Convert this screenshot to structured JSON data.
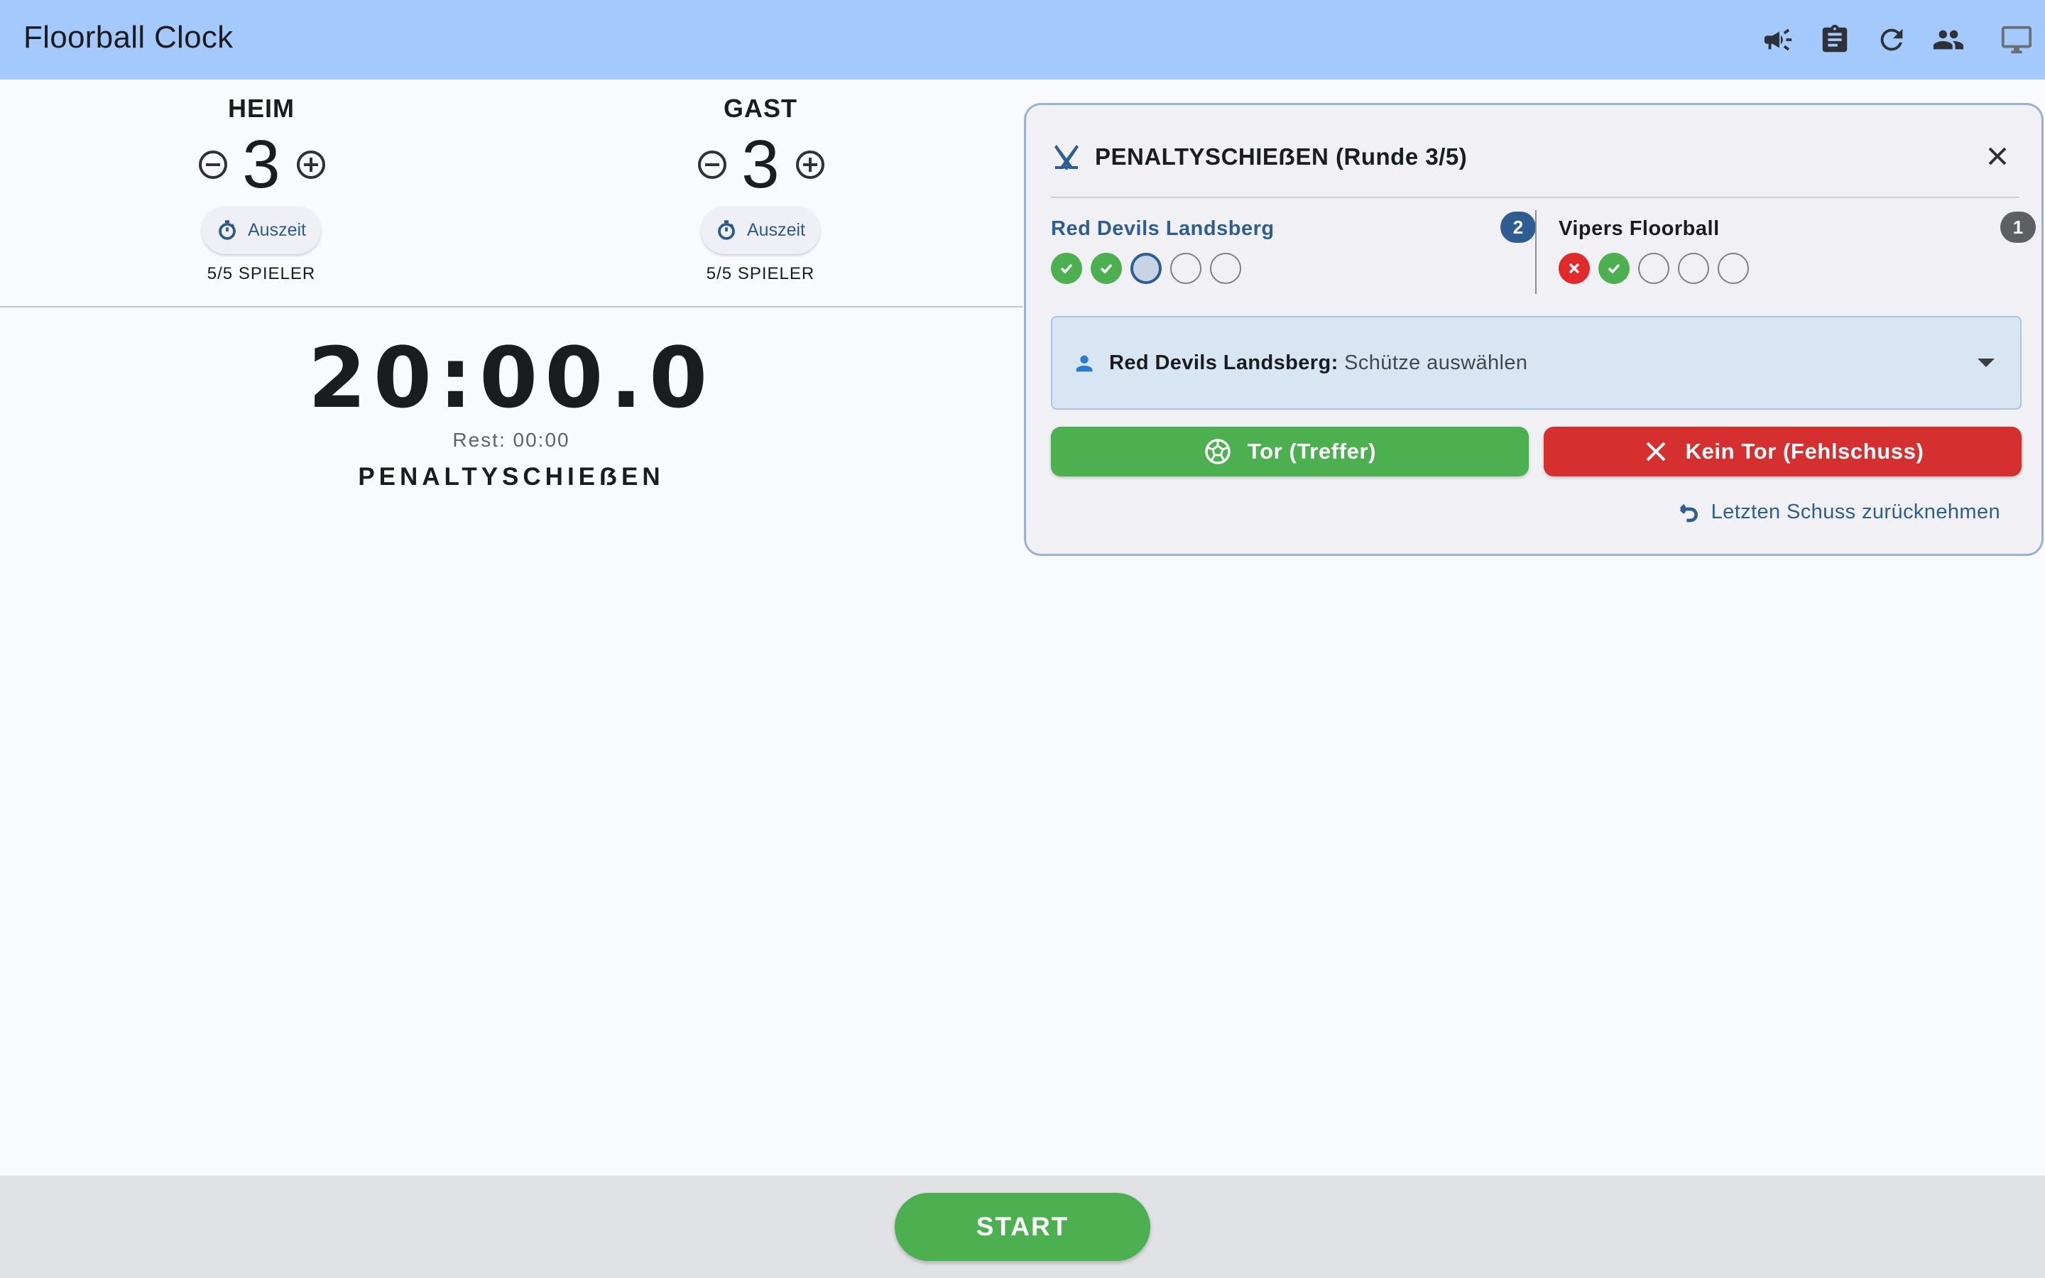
{
  "app": {
    "title": "Floorball Clock",
    "icons": [
      "announcement-icon",
      "clipboard-icon",
      "refresh-icon",
      "group-icon",
      "display-icon"
    ]
  },
  "home": {
    "label": "HEIM",
    "score": "3",
    "timeout_label": "Auszeit",
    "players": "5/5 SPIELER"
  },
  "guest": {
    "label": "GAST",
    "score": "3",
    "timeout_label": "Auszeit",
    "players": "5/5 SPIELER"
  },
  "clock": {
    "time": "20:00.0",
    "rest": "Rest: 00:00",
    "phase": "PENALTYSCHIEẞEN"
  },
  "penalty": {
    "title": "PENALTYSCHIEẞEN (Runde 3/5)",
    "home_team": {
      "name": "Red Devils Landsberg",
      "goals": "2",
      "shots": [
        "hit",
        "hit",
        "current",
        "empty",
        "empty"
      ]
    },
    "guest_team": {
      "name": "Vipers Floorball",
      "goals": "1",
      "shots": [
        "miss",
        "hit",
        "empty",
        "empty",
        "empty"
      ]
    },
    "shooter": {
      "team_prefix": "Red Devils Landsberg:",
      "placeholder": "Schütze auswählen"
    },
    "goal_button": "Tor (Treffer)",
    "miss_button": "Kein Tor (Fehlschuss)",
    "undo_link": "Letzten Schuss zurücknehmen"
  },
  "bottom": {
    "start_label": "START"
  },
  "colors": {
    "appbar": "#a3c9fd",
    "accent": "#2e5e91",
    "goal": "#4caf50",
    "miss": "#d62f2f"
  }
}
